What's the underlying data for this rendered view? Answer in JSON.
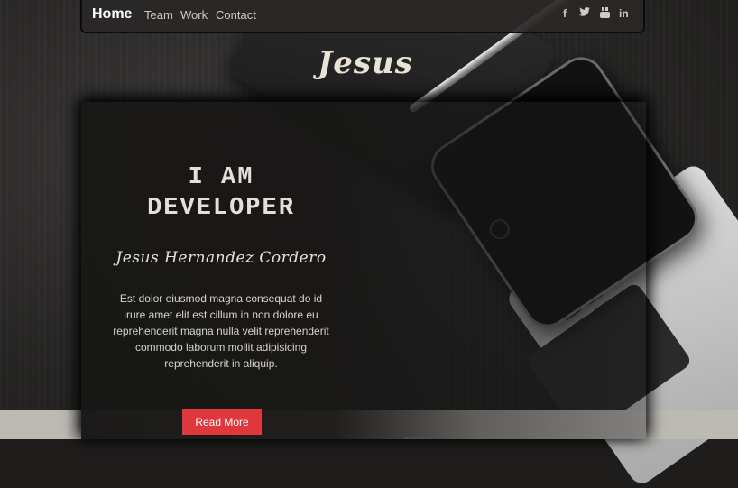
{
  "nav": {
    "home": "Home",
    "items": [
      "Team",
      "Work",
      "Contact"
    ],
    "social": [
      {
        "icon": "facebook-icon",
        "glyph": "f"
      },
      {
        "icon": "twitter-icon",
        "glyph": "🐦"
      },
      {
        "icon": "youtube-icon",
        "glyph": "▶"
      },
      {
        "icon": "linkedin-icon",
        "glyph": "in"
      }
    ]
  },
  "brand": "Jesus",
  "hero": {
    "headline_1": "I AM",
    "headline_2": "DEVELOPER",
    "name": "Jesus Hernandez Cordero",
    "description": "Est dolor eiusmod magna consequat do id irure amet elit est cillum in non dolore eu reprehenderit magna nulla velit reprehenderit commodo laborum mollit adipisicing reprehenderit in aliquip.",
    "button": "Read More"
  },
  "colors": {
    "accent": "#e0373c",
    "panel": "#181716",
    "text_light": "#e4dfd7"
  }
}
